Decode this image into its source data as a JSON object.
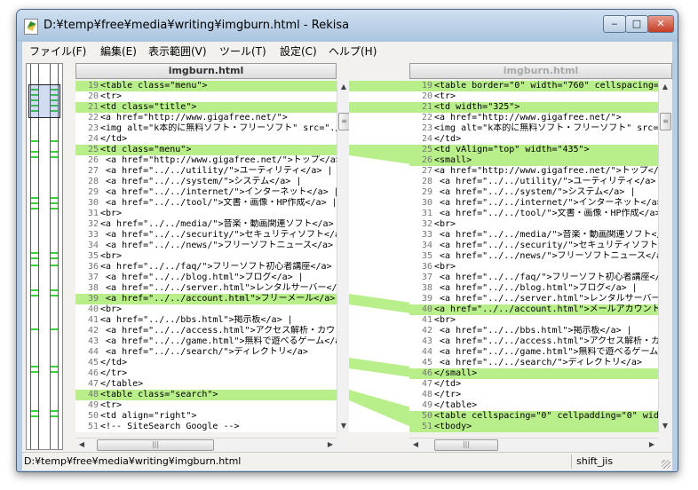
{
  "window": {
    "title": "D:¥temp¥free¥media¥writing¥imgburn.html - Rekisa",
    "controls": [
      "minimize-icon",
      "maximize-icon",
      "close-icon"
    ]
  },
  "menu": [
    "ファイル(F)",
    "編集(E)",
    "表示範囲(V)",
    "ツール(T)",
    "設定(C)",
    "ヘルプ(H)"
  ],
  "left": {
    "title": "imgburn.html",
    "lines": [
      {
        "n": "19",
        "text": "<table class=\"menu\">",
        "hl": true
      },
      {
        "n": "20",
        "text": "<tr>",
        "hl": false
      },
      {
        "n": "21",
        "text": "<td class=\"title\">",
        "hl": true
      },
      {
        "n": "22",
        "text": "<a href=\"http://www.gigafree.net/\">",
        "hl": false
      },
      {
        "n": "23",
        "text": "<img alt=\"k本的に無料ソフト・フリーソフト\" src=\"./",
        "hl": false
      },
      {
        "n": "24",
        "text": "</td>",
        "hl": false
      },
      {
        "n": "25",
        "text": "<td class=\"menu\">",
        "hl": true
      },
      {
        "n": "26",
        "text": " <a href=\"http://www.gigafree.net/\">トップ</a> |",
        "hl": false
      },
      {
        "n": "27",
        "text": " <a href=\"../../utility/\">ユーティリティ</a> |",
        "hl": false
      },
      {
        "n": "28",
        "text": " <a href=\"../../system/\">システム</a> |",
        "hl": false
      },
      {
        "n": "29",
        "text": " <a href=\"../../internet/\">インターネット</a> |",
        "hl": false
      },
      {
        "n": "30",
        "text": " <a href=\"../../tool/\">文書・画像・HP作成</a> |",
        "hl": false
      },
      {
        "n": "31",
        "text": "<br>",
        "hl": false
      },
      {
        "n": "32",
        "text": "<a href=\"../../media/\">音楽・動画関連ソフト</a>",
        "hl": false
      },
      {
        "n": "33",
        "text": " <a href=\"../../security/\">セキュリティソフト</a> |",
        "hl": false
      },
      {
        "n": "34",
        "text": " <a href=\"../../news/\">フリーソフトニュース</a> |",
        "hl": false
      },
      {
        "n": "35",
        "text": "<br>",
        "hl": false
      },
      {
        "n": "36",
        "text": "<a href=\"../../faq/\">フリーソフト初心者講座</a> |",
        "hl": false
      },
      {
        "n": "37",
        "text": " <a href=\"../../blog.html\">ブログ</a> |",
        "hl": false
      },
      {
        "n": "38",
        "text": " <a href=\"../../server.html\">レンタルサーバー</a> |",
        "hl": false
      },
      {
        "n": "39",
        "text": " <a href=\"../../account.html\">フリーメール</a> |",
        "hl": true
      },
      {
        "n": "40",
        "text": "<br>",
        "hl": false
      },
      {
        "n": "41",
        "text": "<a href=\"../../bbs.html\">掲示板</a> |",
        "hl": false
      },
      {
        "n": "42",
        "text": " <a href=\"../../access.html\">アクセス解析・カウンタ",
        "hl": false
      },
      {
        "n": "43",
        "text": " <a href=\"../../game.html\">無料で遊べるゲーム</a",
        "hl": false
      },
      {
        "n": "44",
        "text": " <a href=\"../../search/\">ディレクトリ</a>",
        "hl": false
      },
      {
        "n": "45",
        "text": "</td>",
        "hl": false
      },
      {
        "n": "46",
        "text": "</tr>",
        "hl": false
      },
      {
        "n": "47",
        "text": "</table>",
        "hl": false
      },
      {
        "n": "48",
        "text": "<table class=\"search\">",
        "hl": true
      },
      {
        "n": "49",
        "text": "<tr>",
        "hl": false
      },
      {
        "n": "50",
        "text": "<td align=\"right\">",
        "hl": false
      },
      {
        "n": "51",
        "text": "<!-- SiteSearch Google -->",
        "hl": false
      }
    ]
  },
  "right": {
    "title": "imgburn.html",
    "lines": [
      {
        "n": "19",
        "text": "<table border=\"0\" width=\"760\" cellspacing=\"0\">",
        "hl": true
      },
      {
        "n": "20",
        "text": "<tr>",
        "hl": false
      },
      {
        "n": "21",
        "text": "<td width=\"325\">",
        "hl": true
      },
      {
        "n": "22",
        "text": "<a href=\"http://www.gigafree.net/\">",
        "hl": false
      },
      {
        "n": "23",
        "text": "<img alt=\"k本的に無料ソフト・フリーソフト\" src=\"./",
        "hl": false
      },
      {
        "n": "24",
        "text": "</td>",
        "hl": false
      },
      {
        "n": "25",
        "text": "<td vAlign=\"top\" width=\"435\">",
        "hl": true
      },
      {
        "n": "26",
        "text": "<small>",
        "hl": true
      },
      {
        "n": "27",
        "text": "<a href=\"http://www.gigafree.net/\">トップ</a> |",
        "hl": false
      },
      {
        "n": "28",
        "text": " <a href=\"../../utility/\">ユーティリティ</a> |",
        "hl": false
      },
      {
        "n": "29",
        "text": " <a href=\"../../system/\">システム</a> |",
        "hl": false
      },
      {
        "n": "30",
        "text": " <a href=\"../../internet/\">インターネット</a> |",
        "hl": false
      },
      {
        "n": "31",
        "text": " <a href=\"../../tool/\">文書・画像・HP作成</a> |",
        "hl": false
      },
      {
        "n": "32",
        "text": "<br>",
        "hl": false
      },
      {
        "n": "33",
        "text": " <a href=\"../../media/\">音楽・動画関連ソフト</a>",
        "hl": false
      },
      {
        "n": "34",
        "text": " <a href=\"../../security/\">セキュリティソフト</a> |",
        "hl": false
      },
      {
        "n": "35",
        "text": " <a href=\"../../news/\">フリーソフトニュース</a> |",
        "hl": false
      },
      {
        "n": "36",
        "text": "<br>",
        "hl": false
      },
      {
        "n": "37",
        "text": " <a href=\"../../faq/\">フリーソフト初心者講座</a> |",
        "hl": false
      },
      {
        "n": "38",
        "text": " <a href=\"../../blog.html\">ブログ</a> |",
        "hl": false
      },
      {
        "n": "39",
        "text": " <a href=\"../../server.html\">レンタルサーバー</a> |",
        "hl": false
      },
      {
        "n": "40",
        "text": "<a href=\"../../account.html\">メールアカウント</a> |",
        "hl": true
      },
      {
        "n": "41",
        "text": "<br>",
        "hl": false
      },
      {
        "n": "42",
        "text": " <a href=\"../../bbs.html\">掲示板</a> |",
        "hl": false
      },
      {
        "n": "43",
        "text": " <a href=\"../../access.html\">アクセス解析・カウンタ",
        "hl": false
      },
      {
        "n": "44",
        "text": " <a href=\"../../game.html\">無料で遊べるゲーム</a",
        "hl": false
      },
      {
        "n": "45",
        "text": " <a href=\"../../search/\">ディレクトリ</a>",
        "hl": false
      },
      {
        "n": "46",
        "text": "</small>",
        "hl": true
      },
      {
        "n": "47",
        "text": "</td>",
        "hl": false
      },
      {
        "n": "48",
        "text": "</tr>",
        "hl": false
      },
      {
        "n": "49",
        "text": "</table>",
        "hl": false
      },
      {
        "n": "50",
        "text": "<table cellspacing=\"0\" cellpadding=\"0\" width=\"7",
        "hl": true
      },
      {
        "n": "51",
        "text": "<tbody>",
        "hl": true
      }
    ]
  },
  "links": [
    {
      "from": "19",
      "to": "19"
    },
    {
      "from": "21",
      "to": "21"
    },
    {
      "from": "25",
      "to": "25-26"
    },
    {
      "from": "39",
      "to": "40"
    },
    {
      "from": "45",
      "to": "46"
    },
    {
      "from": "48",
      "to": "50-51"
    }
  ],
  "status": {
    "path": "D:¥temp¥free¥media¥writing¥imgburn.html",
    "encoding": "shift_jis"
  },
  "colors": {
    "highlight": "#b9ef8b",
    "connector": "#b9ef8b",
    "overview_mark": "#3ad03a"
  }
}
